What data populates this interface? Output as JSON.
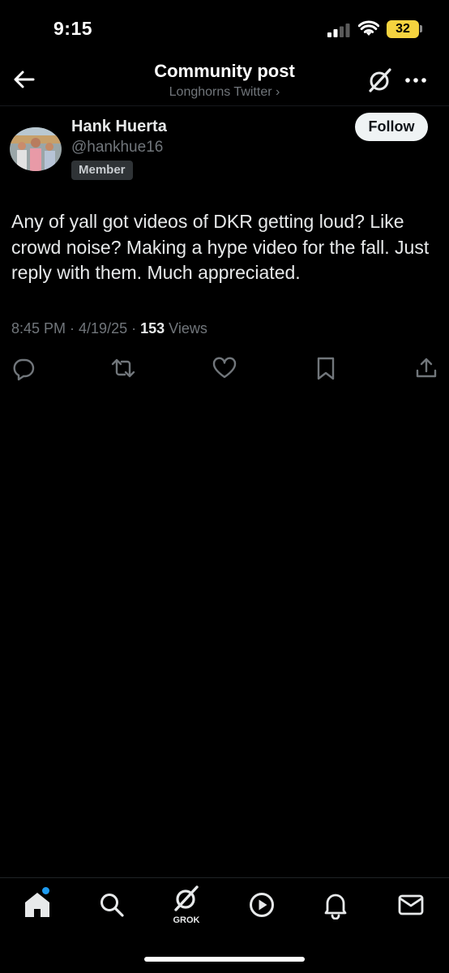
{
  "status_bar": {
    "time": "9:15",
    "battery": "32",
    "icons": [
      "cellular-signal-icon",
      "wifi-icon",
      "battery-icon"
    ]
  },
  "header": {
    "title": "Community post",
    "subtitle": "Longhorns Twitter ›",
    "icons": [
      "back-arrow-icon",
      "grok-icon",
      "more-icon"
    ]
  },
  "post": {
    "author_name": "Hank Huerta",
    "handle": "@hankhue16",
    "badge": "Member",
    "follow_label": "Follow",
    "text": "Any of yall got videos of DKR getting loud? Like crowd noise? Making a hype video for the fall. Just reply with them. Much appreciated.",
    "timestamp": "8:45 PM · 4/19/25 · ",
    "views_count": "153",
    "views_label": " Views",
    "actions": [
      "reply-icon",
      "repost-icon",
      "like-icon",
      "bookmark-icon",
      "share-icon"
    ]
  },
  "bottom_nav": {
    "items": [
      "home-icon",
      "search-icon",
      "grok-icon",
      "video-icon",
      "notifications-icon",
      "messages-icon"
    ],
    "grok_label": "GROK"
  },
  "colors": {
    "background": "#000000",
    "text_primary": "#e7e9ea",
    "text_secondary": "#71767b",
    "battery": "#f5d33f",
    "notification_dot": "#1d9bf0"
  }
}
